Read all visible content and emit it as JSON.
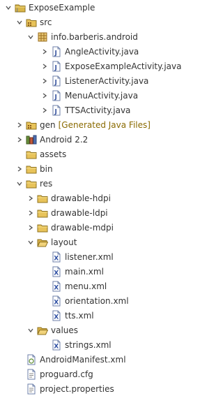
{
  "colors": {
    "text": "#333333",
    "decoration": "#8a6a00",
    "folder": "#e8c35a",
    "java": "#3a56a0",
    "xml": "#2e4fa3"
  },
  "tree": [
    {
      "label": "ExposeExample",
      "icon": "project-icon",
      "twisty": "expanded",
      "level": 0
    },
    {
      "label": "src",
      "icon": "source-folder-icon",
      "twisty": "expanded",
      "level": 1
    },
    {
      "label": "info.barberis.android",
      "icon": "package-icon",
      "twisty": "expanded",
      "level": 2
    },
    {
      "label": "AngleActivity.java",
      "icon": "java-file-icon",
      "twisty": "collapsed",
      "level": 3
    },
    {
      "label": "ExposeExampleActivity.java",
      "icon": "java-file-icon",
      "twisty": "collapsed",
      "level": 3
    },
    {
      "label": "ListenerActivity.java",
      "icon": "java-file-icon",
      "twisty": "collapsed",
      "level": 3
    },
    {
      "label": "MenuActivity.java",
      "icon": "java-file-icon",
      "twisty": "collapsed",
      "level": 3
    },
    {
      "label": "TTSActivity.java",
      "icon": "java-file-icon",
      "twisty": "collapsed",
      "level": 3
    },
    {
      "label": "gen",
      "decoration": "[Generated Java Files]",
      "icon": "source-folder-icon",
      "twisty": "collapsed",
      "level": 1
    },
    {
      "label": "Android 2.2",
      "icon": "library-icon",
      "twisty": "collapsed",
      "level": 1
    },
    {
      "label": "assets",
      "icon": "folder-icon",
      "twisty": "none",
      "level": 1
    },
    {
      "label": "bin",
      "icon": "folder-icon",
      "twisty": "collapsed",
      "level": 1
    },
    {
      "label": "res",
      "icon": "folder-icon",
      "twisty": "expanded",
      "level": 1
    },
    {
      "label": "drawable-hdpi",
      "icon": "folder-icon",
      "twisty": "collapsed",
      "level": 2
    },
    {
      "label": "drawable-ldpi",
      "icon": "folder-icon",
      "twisty": "collapsed",
      "level": 2
    },
    {
      "label": "drawable-mdpi",
      "icon": "folder-icon",
      "twisty": "collapsed",
      "level": 2
    },
    {
      "label": "layout",
      "icon": "folder-open-icon",
      "twisty": "expanded",
      "level": 2
    },
    {
      "label": "listener.xml",
      "icon": "xml-file-icon",
      "twisty": "none",
      "level": 3
    },
    {
      "label": "main.xml",
      "icon": "xml-file-icon",
      "twisty": "none",
      "level": 3
    },
    {
      "label": "menu.xml",
      "icon": "xml-file-icon",
      "twisty": "none",
      "level": 3
    },
    {
      "label": "orientation.xml",
      "icon": "xml-file-icon",
      "twisty": "none",
      "level": 3
    },
    {
      "label": "tts.xml",
      "icon": "xml-file-icon",
      "twisty": "none",
      "level": 3
    },
    {
      "label": "values",
      "icon": "folder-open-icon",
      "twisty": "expanded",
      "level": 2
    },
    {
      "label": "strings.xml",
      "icon": "xml-file-icon",
      "twisty": "none",
      "level": 3
    },
    {
      "label": "AndroidManifest.xml",
      "icon": "manifest-file-icon",
      "twisty": "none",
      "level": 1
    },
    {
      "label": "proguard.cfg",
      "icon": "text-file-icon",
      "twisty": "none",
      "level": 1
    },
    {
      "label": "project.properties",
      "icon": "text-file-icon",
      "twisty": "none",
      "level": 1
    }
  ]
}
